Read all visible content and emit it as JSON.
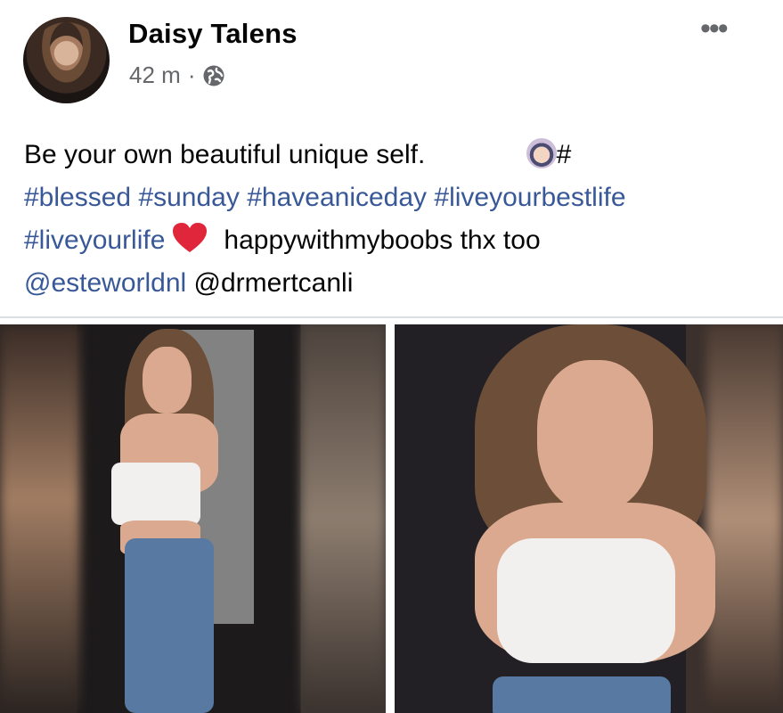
{
  "post": {
    "author": "Daisy Talens",
    "time": "42 m",
    "separator": "·",
    "audience_icon": "globe-icon",
    "more_icon": "more-options-icon",
    "more_label": "•••"
  },
  "text": {
    "line1": "Be your own beautiful unique self.",
    "line1_hash": "#",
    "line2_tags": [
      "#blessed",
      "#sunday",
      "#haveaniceday",
      "#liveyourbestlife"
    ],
    "line3_tag": "#liveyourlife",
    "line3_text": "happywithmyboobs thx too",
    "line4_mention": "@esteworldnl",
    "line4_text": "@drmertcanli",
    "emojis": [
      "woman-raising-hand-emoji",
      "red-heart-emoji"
    ]
  },
  "photos": [
    {
      "name": "photo-1"
    },
    {
      "name": "photo-2"
    }
  ],
  "colors": {
    "link": "#385898",
    "text": "#050505",
    "secondary": "#65676b",
    "divider": "#dadde1"
  }
}
